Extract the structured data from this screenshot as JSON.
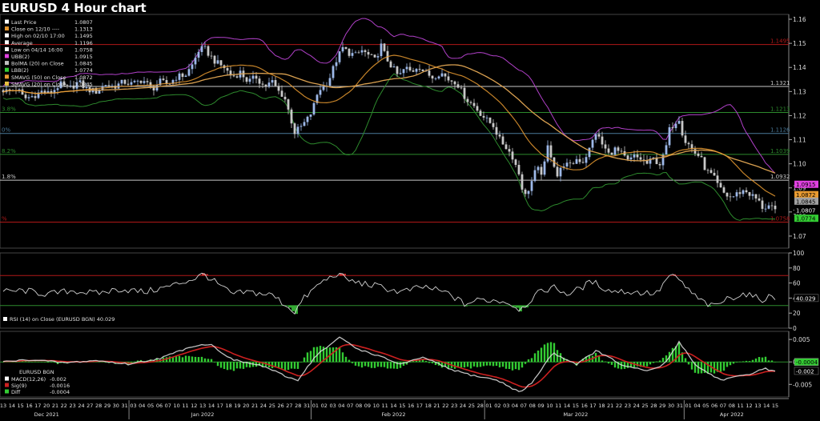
{
  "title": "EURUSD 4 Hour chart",
  "colors": {
    "price_up": "#9db8e8",
    "price_down": "#c8c8c8",
    "ubb": "#b040c8",
    "lbb": "#2d8a2d",
    "sma50": "#d9a050",
    "sma20": "#e89a30",
    "rsi": "#d0d0d0",
    "macd": "#e0e0e0",
    "sig": "#cc2020",
    "diff": "#33cc33",
    "hline_red": "#b01818",
    "hline_white": "#c8c8c8",
    "hline_green": "#2d8a2d",
    "hline_blue": "#4a7a9a"
  },
  "chart_data": [
    {
      "type": "line",
      "title": "EURUSD 4 Hour chart",
      "ylim": [
        1.065,
        1.162
      ],
      "yticks": [
        1.07,
        1.08,
        1.09,
        1.1,
        1.11,
        1.12,
        1.13,
        1.14,
        1.15,
        1.16
      ],
      "ytick_labels": [
        "1.07",
        "1.08",
        "1.09",
        "1.10",
        "1.11",
        "1.12",
        "1.13",
        "1.14",
        "1.15",
        "1.16"
      ],
      "legend": [
        {
          "label": "Last Price",
          "value": "1.0807",
          "color": "#ffffff"
        },
        {
          "label": "Close on 12/10 ----",
          "value": "1.1313",
          "color": "#e89a30"
        },
        {
          "label": "High on 02/10 17:00",
          "value": "1.1495",
          "color": "#ffffff"
        },
        {
          "label": "Average",
          "value": "1.1196",
          "color": "#ffffff"
        },
        {
          "label": "Low on 04/14 16:00",
          "value": "1.0758",
          "color": "#ffffff"
        },
        {
          "label": "UBB(2)",
          "value": "1.0915",
          "color": "#e040e0"
        },
        {
          "label": "BolMA (20)  on Close",
          "value": "1.0845",
          "color": "#c0c0c0"
        },
        {
          "label": "LBB(2)",
          "value": "1.0774",
          "color": "#33cc33"
        },
        {
          "label": "SMAVG (50)  on Close",
          "value": "1.0872",
          "color": "#e89a30"
        },
        {
          "label": "SMAVG (20)  on Close",
          "value": "1.0845",
          "color": "#e8c040"
        }
      ],
      "hlines": [
        {
          "value": 1.1495,
          "label": "1.1495",
          "color": "#b01818",
          "left_label": ""
        },
        {
          "value": 1.1321,
          "label": "1.1321",
          "color": "#c8c8c8",
          "left_label": ""
        },
        {
          "value": 1.1213,
          "label": "1.1213",
          "color": "#2d8a2d",
          "left_label": "3.8%"
        },
        {
          "value": 1.1126,
          "label": "1.1126",
          "color": "#4a7a9a",
          "left_label": "0%"
        },
        {
          "value": 1.1039,
          "label": "1.1039",
          "color": "#2d8a2d",
          "left_label": "8.2%"
        },
        {
          "value": 1.0932,
          "label": "1.0932",
          "color": "#c8c8c8",
          "left_label": "1.8%"
        },
        {
          "value": 1.0758,
          "label": "1.0758",
          "color": "#b01818",
          "left_label": "%"
        }
      ],
      "right_labels": [
        {
          "value": 1.0915,
          "label": "1.0915",
          "bg": "#e040e0",
          "fg": "#000000"
        },
        {
          "value": 1.0872,
          "label": "1.0872",
          "bg": "#e89a30",
          "fg": "#000000"
        },
        {
          "value": 1.0845,
          "label": "1.0845",
          "bg": "#a0a0a0",
          "fg": "#000000"
        },
        {
          "value": 1.0807,
          "label": "1.0807",
          "bg": "#000000",
          "fg": "#ffffff"
        },
        {
          "value": 1.0774,
          "label": "1.0774",
          "bg": "#33cc33",
          "fg": "#000000"
        }
      ],
      "price_anchors": [
        [
          0,
          1.131
        ],
        [
          10,
          1.13
        ],
        [
          22,
          1.131
        ],
        [
          30,
          1.127
        ],
        [
          40,
          1.128
        ],
        [
          52,
          1.13
        ],
        [
          62,
          1.129
        ],
        [
          75,
          1.133
        ],
        [
          86,
          1.131
        ],
        [
          98,
          1.134
        ],
        [
          108,
          1.131
        ],
        [
          120,
          1.13
        ],
        [
          132,
          1.133
        ],
        [
          142,
          1.132
        ],
        [
          155,
          1.134
        ],
        [
          165,
          1.133
        ],
        [
          178,
          1.135
        ],
        [
          190,
          1.131
        ],
        [
          200,
          1.134
        ],
        [
          210,
          1.133
        ],
        [
          220,
          1.136
        ],
        [
          232,
          1.137
        ],
        [
          240,
          1.141
        ],
        [
          248,
          1.147
        ],
        [
          255,
          1.148
        ],
        [
          262,
          1.145
        ],
        [
          270,
          1.142
        ],
        [
          280,
          1.14
        ],
        [
          290,
          1.136
        ],
        [
          300,
          1.138
        ],
        [
          310,
          1.134
        ],
        [
          320,
          1.136
        ],
        [
          330,
          1.132
        ],
        [
          340,
          1.134
        ],
        [
          348,
          1.13
        ],
        [
          355,
          1.128
        ],
        [
          362,
          1.12
        ],
        [
          368,
          1.113
        ],
        [
          375,
          1.115
        ],
        [
          383,
          1.118
        ],
        [
          390,
          1.122
        ],
        [
          398,
          1.131
        ],
        [
          405,
          1.132
        ],
        [
          412,
          1.136
        ],
        [
          420,
          1.143
        ],
        [
          428,
          1.148
        ],
        [
          436,
          1.146
        ],
        [
          444,
          1.145
        ],
        [
          452,
          1.147
        ],
        [
          460,
          1.145
        ],
        [
          468,
          1.143
        ],
        [
          476,
          1.149
        ],
        [
          482,
          1.144
        ],
        [
          490,
          1.14
        ],
        [
          498,
          1.136
        ],
        [
          506,
          1.14
        ],
        [
          514,
          1.138
        ],
        [
          522,
          1.141
        ],
        [
          530,
          1.138
        ],
        [
          540,
          1.136
        ],
        [
          550,
          1.138
        ],
        [
          560,
          1.135
        ],
        [
          570,
          1.134
        ],
        [
          578,
          1.129
        ],
        [
          585,
          1.126
        ],
        [
          592,
          1.124
        ],
        [
          600,
          1.121
        ],
        [
          608,
          1.118
        ],
        [
          616,
          1.116
        ],
        [
          624,
          1.11
        ],
        [
          632,
          1.107
        ],
        [
          640,
          1.103
        ],
        [
          648,
          1.096
        ],
        [
          655,
          1.086
        ],
        [
          662,
          1.091
        ],
        [
          670,
          1.098
        ],
        [
          678,
          1.096
        ],
        [
          684,
          1.107
        ],
        [
          690,
          1.102
        ],
        [
          696,
          1.095
        ],
        [
          704,
          1.1
        ],
        [
          712,
          1.099
        ],
        [
          720,
          1.102
        ],
        [
          728,
          1.101
        ],
        [
          736,
          1.106
        ],
        [
          744,
          1.113
        ],
        [
          752,
          1.108
        ],
        [
          760,
          1.104
        ],
        [
          768,
          1.106
        ],
        [
          776,
          1.104
        ],
        [
          784,
          1.101
        ],
        [
          792,
          1.103
        ],
        [
          800,
          1.102
        ],
        [
          808,
          1.1
        ],
        [
          816,
          1.102
        ],
        [
          824,
          1.1
        ],
        [
          830,
          1.104
        ],
        [
          836,
          1.114
        ],
        [
          842,
          1.117
        ],
        [
          848,
          1.119
        ],
        [
          854,
          1.11
        ],
        [
          860,
          1.108
        ],
        [
          866,
          1.105
        ],
        [
          874,
          1.103
        ],
        [
          882,
          1.097
        ],
        [
          890,
          1.095
        ],
        [
          898,
          1.09
        ],
        [
          906,
          1.087
        ],
        [
          914,
          1.086
        ],
        [
          922,
          1.088
        ],
        [
          930,
          1.089
        ],
        [
          938,
          1.087
        ],
        [
          946,
          1.085
        ],
        [
          954,
          1.081
        ],
        [
          958,
          1.083
        ],
        [
          962,
          1.082
        ],
        [
          968,
          1.08
        ]
      ]
    },
    {
      "type": "line",
      "title": "RSI (14)  on Close (EURUSD BGN) 40.029",
      "ylim": [
        0,
        100
      ],
      "yticks": [
        0,
        20,
        40,
        60,
        80,
        100
      ],
      "ytick_labels": [
        "0",
        "20",
        "40",
        "60",
        "80",
        "100"
      ],
      "hlines": [
        70,
        30
      ],
      "last_label": "40.029",
      "anchors": [
        [
          0,
          48
        ],
        [
          30,
          50
        ],
        [
          60,
          45
        ],
        [
          90,
          50
        ],
        [
          120,
          46
        ],
        [
          150,
          52
        ],
        [
          180,
          48
        ],
        [
          210,
          55
        ],
        [
          240,
          65
        ],
        [
          255,
          72
        ],
        [
          270,
          60
        ],
        [
          290,
          45
        ],
        [
          310,
          48
        ],
        [
          340,
          44
        ],
        [
          360,
          28
        ],
        [
          368,
          22
        ],
        [
          380,
          40
        ],
        [
          400,
          60
        ],
        [
          420,
          72
        ],
        [
          440,
          62
        ],
        [
          470,
          56
        ],
        [
          500,
          48
        ],
        [
          530,
          55
        ],
        [
          560,
          46
        ],
        [
          580,
          32
        ],
        [
          600,
          38
        ],
        [
          630,
          36
        ],
        [
          650,
          25
        ],
        [
          670,
          45
        ],
        [
          690,
          55
        ],
        [
          710,
          45
        ],
        [
          740,
          62
        ],
        [
          760,
          50
        ],
        [
          790,
          48
        ],
        [
          820,
          46
        ],
        [
          836,
          70
        ],
        [
          848,
          64
        ],
        [
          870,
          40
        ],
        [
          890,
          28
        ],
        [
          910,
          40
        ],
        [
          930,
          46
        ],
        [
          950,
          38
        ],
        [
          962,
          42
        ],
        [
          968,
          40
        ]
      ]
    },
    {
      "type": "line",
      "title": "EURUSD BGN",
      "ylim": [
        -0.0078,
        0.0068
      ],
      "yticks": [
        0.005,
        0,
        -0.005
      ],
      "ytick_labels": [
        "0.005",
        "0",
        "-0.005"
      ],
      "legend": [
        {
          "label": "MACD(12,26)",
          "value": "-0.002",
          "color": "#ffffff"
        },
        {
          "label": "Sig(9)",
          "value": "-0.0016",
          "color": "#cc2020"
        },
        {
          "label": "Diff",
          "value": "-0.0004",
          "color": "#33cc33"
        }
      ],
      "right_labels": [
        {
          "value": 0.0,
          "label": "-0.0004",
          "bg": "#33cc33",
          "fg": "#000000"
        },
        {
          "value": -0.002,
          "label": "-0.002",
          "bg": "#000000",
          "fg": "#ffffff"
        }
      ],
      "macd_anchors": [
        [
          0,
          0.0
        ],
        [
          40,
          0.0005
        ],
        [
          80,
          -0.0002
        ],
        [
          120,
          0.0003
        ],
        [
          160,
          -0.0005
        ],
        [
          200,
          0.0008
        ],
        [
          240,
          0.0035
        ],
        [
          262,
          0.004
        ],
        [
          290,
          0.0005
        ],
        [
          330,
          -0.001
        ],
        [
          360,
          -0.0035
        ],
        [
          372,
          -0.004
        ],
        [
          395,
          0.0015
        ],
        [
          425,
          0.0055
        ],
        [
          445,
          0.003
        ],
        [
          470,
          0.0015
        ],
        [
          500,
          -0.0005
        ],
        [
          530,
          0.001
        ],
        [
          560,
          -0.0015
        ],
        [
          590,
          -0.003
        ],
        [
          620,
          -0.004
        ],
        [
          650,
          -0.0068
        ],
        [
          665,
          -0.0045
        ],
        [
          690,
          0.002
        ],
        [
          720,
          -0.0005
        ],
        [
          745,
          0.0025
        ],
        [
          780,
          -0.001
        ],
        [
          810,
          -0.002
        ],
        [
          830,
          -0.0005
        ],
        [
          848,
          0.0045
        ],
        [
          870,
          -0.001
        ],
        [
          900,
          -0.004
        ],
        [
          930,
          -0.003
        ],
        [
          955,
          -0.0015
        ],
        [
          968,
          -0.002
        ]
      ]
    }
  ],
  "x_axis": {
    "day_labels": [
      "13",
      "14",
      "15",
      "16",
      "17",
      "20",
      "21",
      "22",
      "23",
      "24",
      "27",
      "28",
      "29",
      "30",
      "31",
      "03",
      "04",
      "05",
      "06",
      "07",
      "10",
      "11",
      "12",
      "13",
      "14",
      "17",
      "18",
      "19",
      "20",
      "21",
      "24",
      "25",
      "26",
      "27",
      "28",
      "31",
      "01",
      "02",
      "03",
      "04",
      "07",
      "08",
      "09",
      "10",
      "11",
      "14",
      "15",
      "16",
      "17",
      "18",
      "21",
      "22",
      "23",
      "24",
      "25",
      "28",
      "01",
      "02",
      "03",
      "04",
      "07",
      "08",
      "09",
      "10",
      "11",
      "14",
      "15",
      "16",
      "17",
      "18",
      "21",
      "22",
      "23",
      "24",
      "25",
      "28",
      "29",
      "30",
      "31",
      "01",
      "04",
      "05",
      "06",
      "07",
      "08",
      "11",
      "12",
      "13",
      "14",
      "15"
    ],
    "months": [
      {
        "label": "Dec 2021",
        "at": 5
      },
      {
        "label": "Jan 2022",
        "at": 23
      },
      {
        "label": "Feb 2022",
        "at": 45
      },
      {
        "label": "Mar 2022",
        "at": 66
      },
      {
        "label": "Apr 2022",
        "at": 84
      }
    ]
  }
}
